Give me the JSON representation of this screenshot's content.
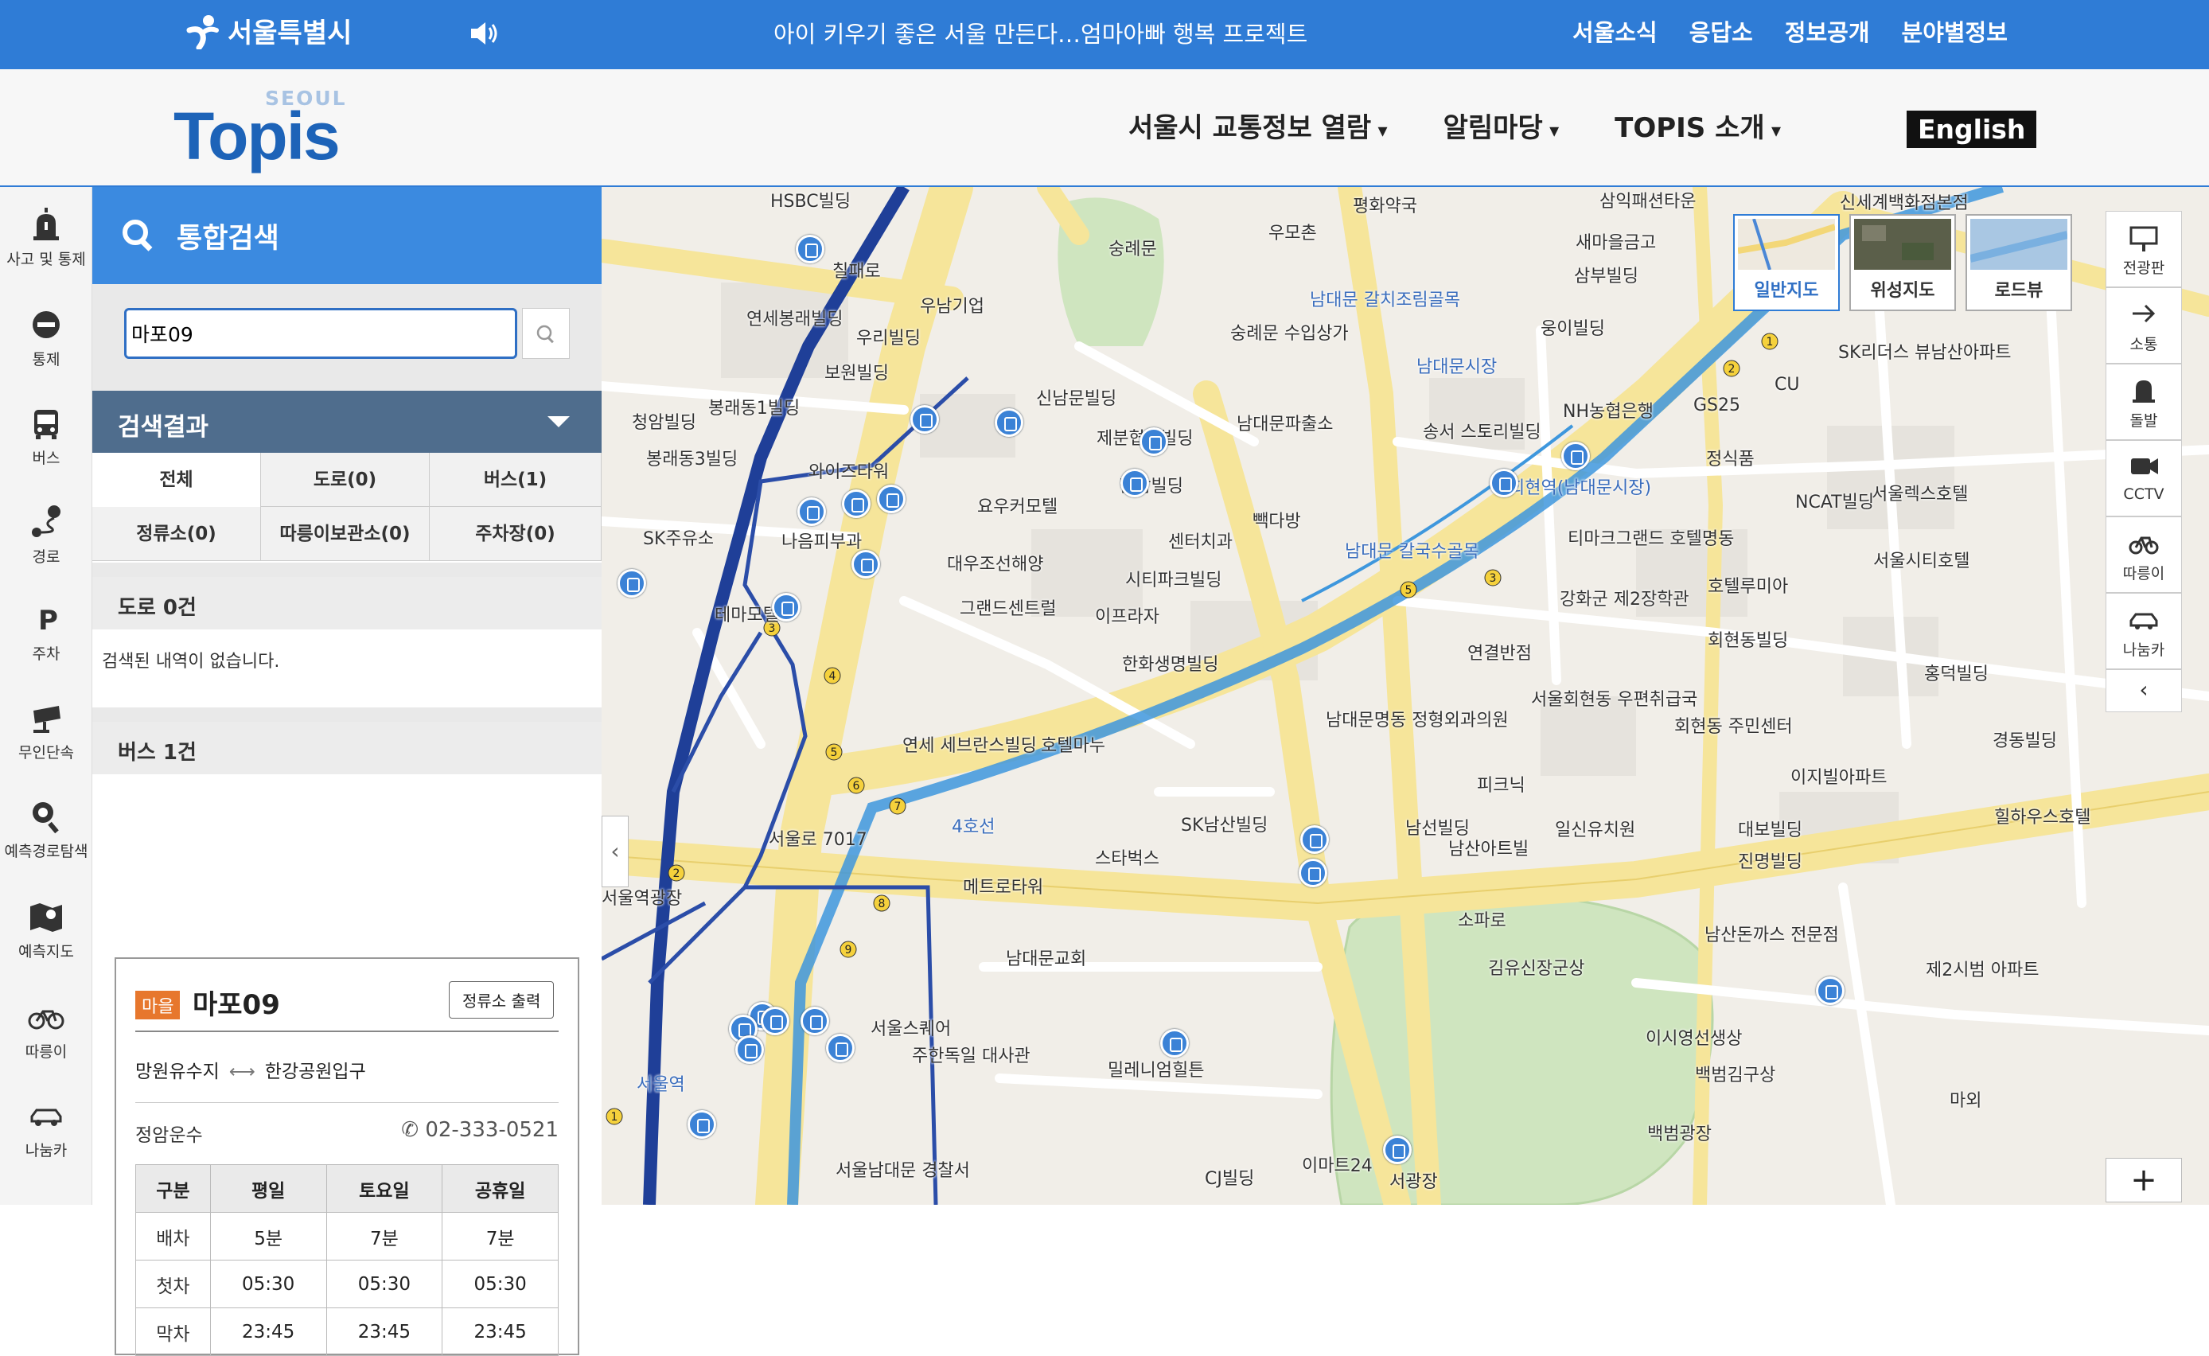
{
  "topbar": {
    "city_name": "서울특별시",
    "ticker": "아이 키우기 좋은 서울 만든다…엄마아빠 행복 프로젝트",
    "links": [
      "서울소식",
      "응답소",
      "정보공개",
      "분야별정보"
    ]
  },
  "header": {
    "brand_small": "SEOUL",
    "brand": "Topis",
    "menu": [
      "서울시 교통정보 열람",
      "알림마당",
      "TOPIS 소개"
    ],
    "english": "English"
  },
  "iconbar": [
    {
      "label": "사고 및 통제",
      "icon": "siren-icon"
    },
    {
      "label": "통제",
      "icon": "no-entry-icon"
    },
    {
      "label": "버스",
      "icon": "bus-icon"
    },
    {
      "label": "경로",
      "icon": "route-icon"
    },
    {
      "label": "주차",
      "icon": "parking-icon"
    },
    {
      "label": "무인단속",
      "icon": "camera-icon"
    },
    {
      "label": "예측경로탐색",
      "icon": "search-pin-icon"
    },
    {
      "label": "예측지도",
      "icon": "map-icon"
    },
    {
      "label": "따릉이",
      "icon": "bike-icon"
    },
    {
      "label": "나눔카",
      "icon": "car-icon"
    }
  ],
  "panel": {
    "title": "통합검색",
    "search_value": "마포09",
    "results_title": "검색결과",
    "tabs": [
      "전체",
      "도로(0)",
      "버스(1)",
      "정류소(0)",
      "따릉이보관소(0)",
      "주차장(0)"
    ],
    "road_header": "도로 0건",
    "road_empty": "검색된 내역이 없습니다.",
    "bus_header": "버스 1건",
    "bus": {
      "badge": "마을",
      "number": "마포09",
      "print_button": "정류소 출력",
      "from": "망원유수지",
      "to": "한강공원입구",
      "company": "정암운수",
      "phone": "02-333-0521",
      "table_headers": [
        "구분",
        "평일",
        "토요일",
        "공휴일"
      ],
      "rows": [
        [
          "배차",
          "5분",
          "7분",
          "7분"
        ],
        [
          "첫차",
          "05:30",
          "05:30",
          "05:30"
        ],
        [
          "막차",
          "23:45",
          "23:45",
          "23:45"
        ]
      ]
    }
  },
  "map": {
    "types": [
      "일반지도",
      "위성지도",
      "로드뷰"
    ],
    "tools": [
      "전광판",
      "소통",
      "돌발",
      "CCTV",
      "따릉이",
      "나눔카"
    ],
    "zoom_in": "+",
    "collapse_arrow": "‹",
    "tool_collapse": "‹",
    "labels": [
      "HSBC빌딩",
      "숭례문",
      "우모촌",
      "평화약국",
      "삼익패션타운",
      "신세계백화점본점",
      "새마을금고",
      "칠패로",
      "연세봉래빌딩",
      "우남기업",
      "우리빌딩",
      "숭례문 수입상가",
      "남대문 갈치조림골목",
      "웅이빌딩",
      "삼부빌딩",
      "보원빌딩",
      "남대문시장",
      "NH농협은행",
      "신남문빌딩",
      "청암빌딩",
      "봉래동1빌딩",
      "봉래동3빌딩",
      "와이즈타워",
      "제분협회빌딩",
      "남대문파출소",
      "송서 스토리빌딩",
      "정식품",
      "단암빌딩",
      "요우커모텔",
      "SK주유소",
      "나음피부과",
      "센터치과",
      "빽다방",
      "시티파크빌딩",
      "대우조선해양",
      "그랜드센트럴",
      "이프라자",
      "남대문 칼국수골목",
      "테마모텔",
      "강화군 제2장학관",
      "한화생명빌딩",
      "연결반점",
      "호텔마누",
      "연세 세브란스빌딩",
      "서울회현동 우편취급국",
      "남대문명동 정형외과의원",
      "피크닉",
      "회현동 주민센터",
      "SK남산빌딩",
      "스타벅스",
      "남선빌딩",
      "남산아트빌",
      "일신유치원",
      "대보빌딩",
      "진명빌딩",
      "메트로타워",
      "서울역광장",
      "남대문교회",
      "서울스퀘어",
      "주한독일 대사관",
      "밀레니엄힐튼",
      "남산돈까스 전문점",
      "김유신장군상",
      "이시영선생상",
      "백범김구상",
      "백범광장",
      "이마트24",
      "서광장",
      "CJ빌딩",
      "서울남대문 경찰서",
      "서울렉스호텔",
      "서울시티호텔",
      "호텔루미아",
      "회현동빌딩",
      "홍덕빌딩",
      "경동빌딩",
      "힐하우스호텔",
      "제2시범 아파트",
      "마외",
      "GS25",
      "CU",
      "SK리더스 뷰남산아파트",
      "NCAT빌딩",
      "티마크그랜드 호텔명동",
      "이지빌아파트",
      "서울로 7017",
      "소파로",
      "4호선",
      "서울역",
      "회현역(남대문시장)"
    ]
  },
  "colors": {
    "primary_blue": "#2f7cd6",
    "result_header": "#4f6d8d",
    "bus_badge": "#e7772d",
    "subway_line4": "#3e97dd",
    "subway_line1": "#1f3f98"
  }
}
